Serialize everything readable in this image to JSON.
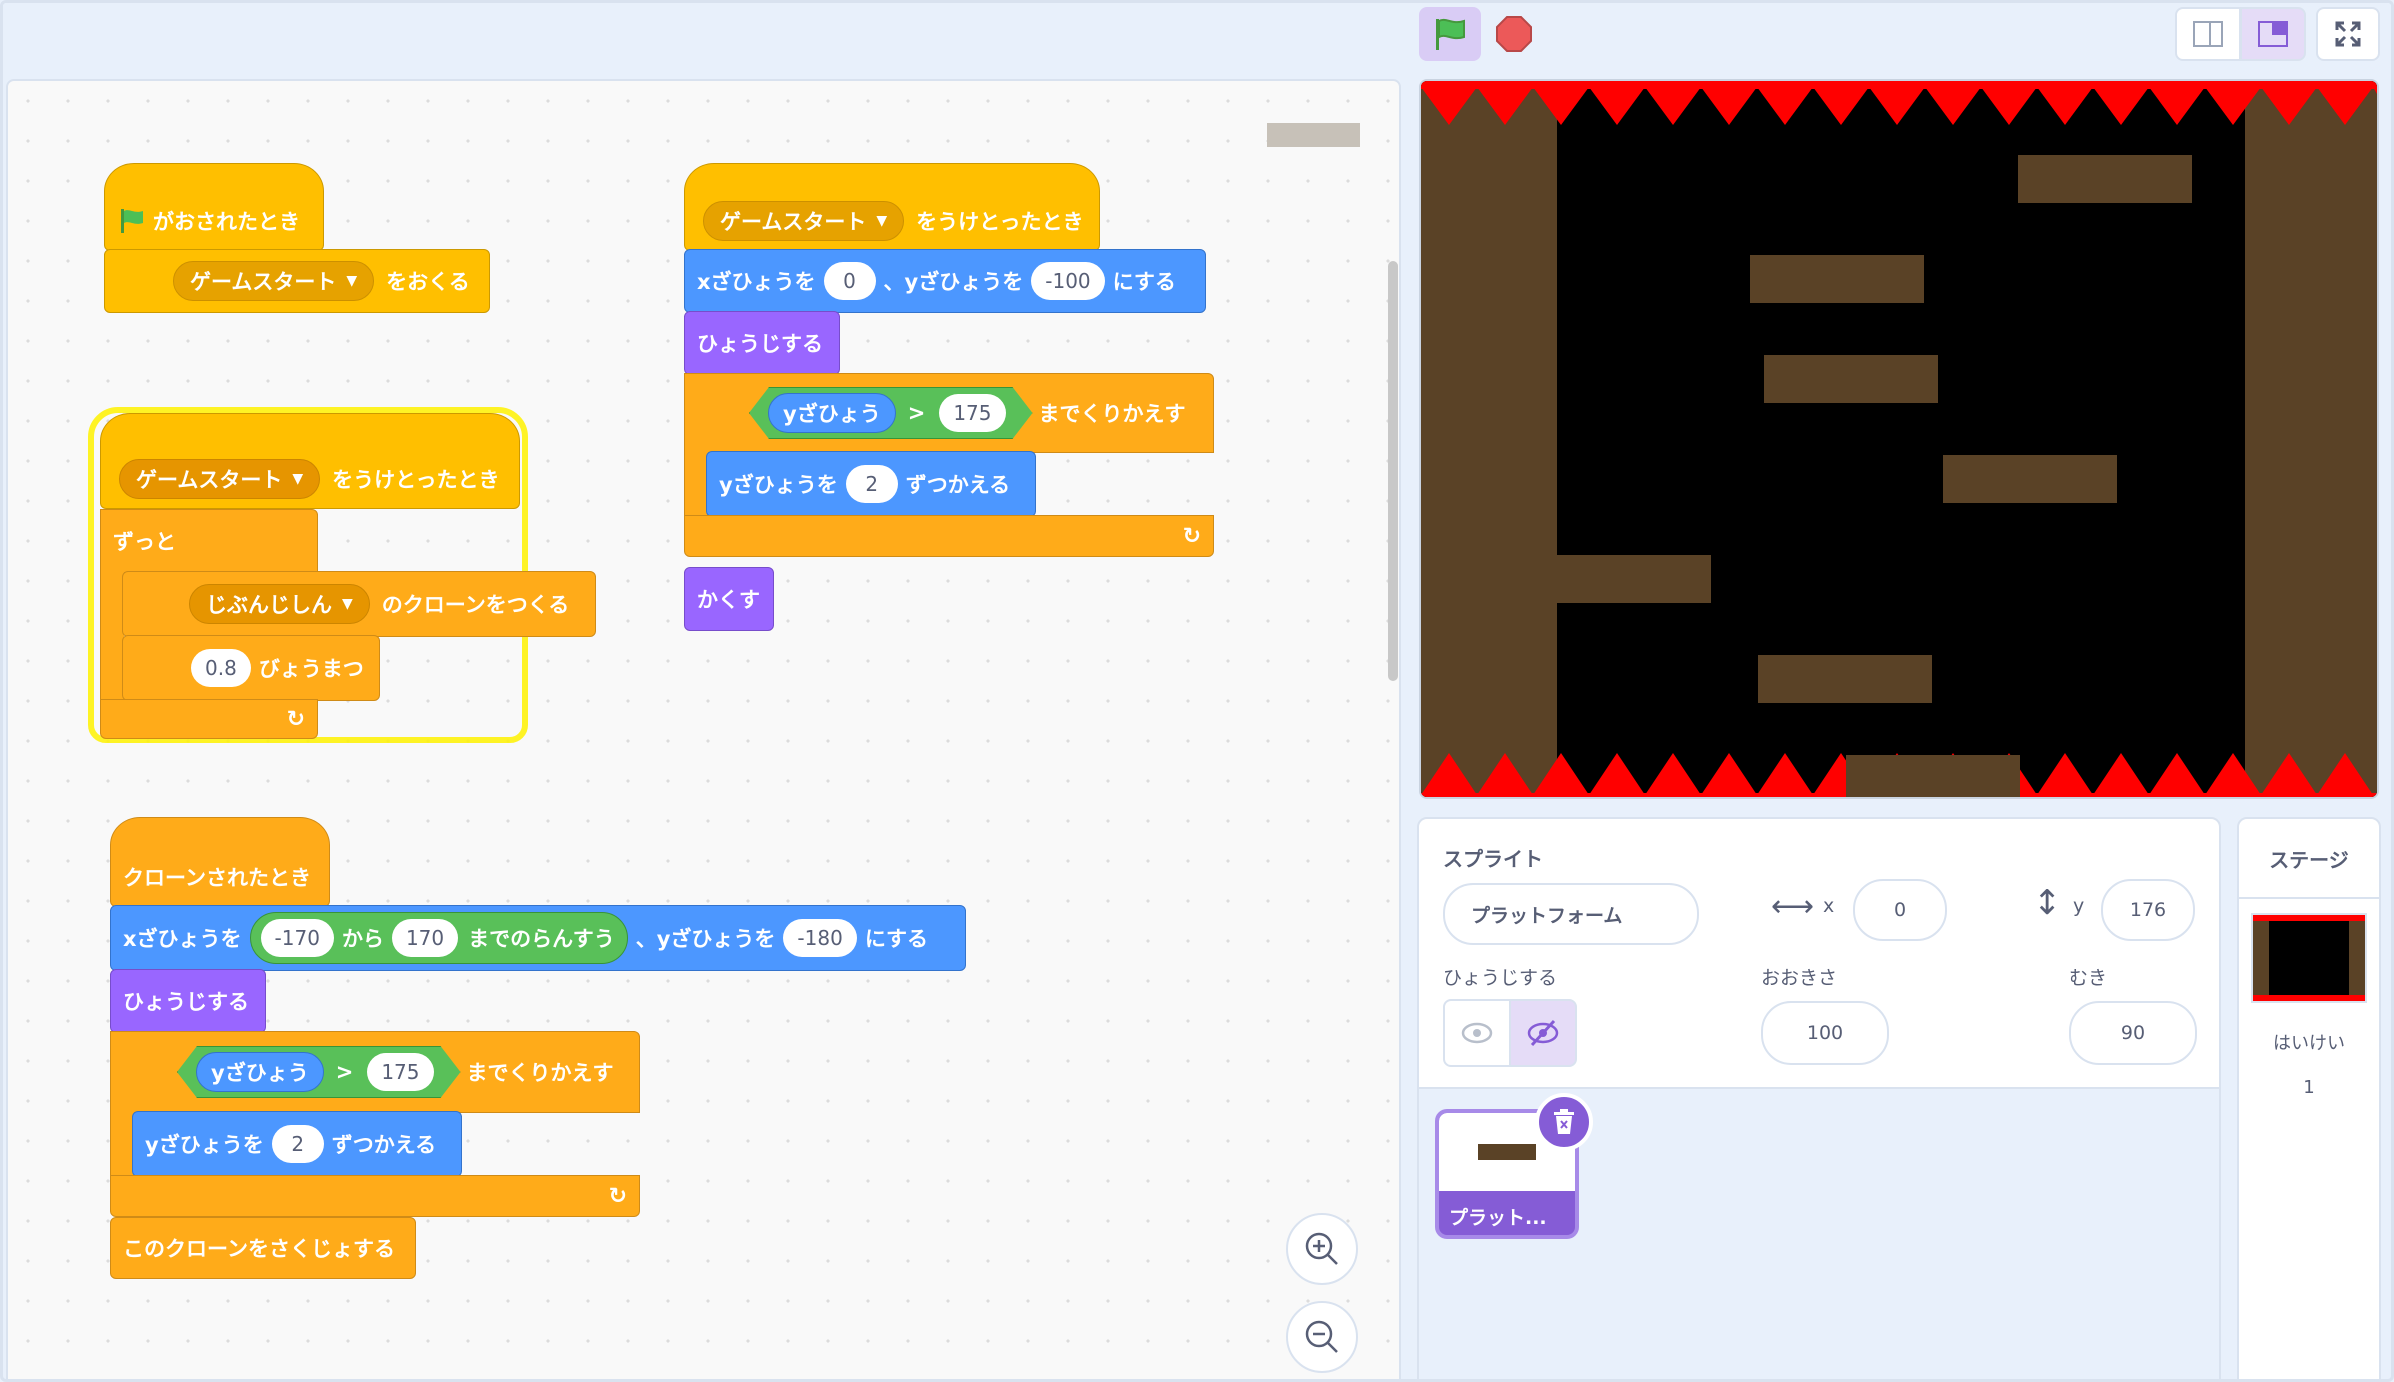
{
  "blocks": {
    "s1": {
      "hat": "がおされたとき",
      "msg": "ゲームスタート",
      "send": "をおくる"
    },
    "s2": {
      "hat_msg": "ゲームスタート",
      "hat_txt": "をうけとったとき",
      "forever": "ずっと",
      "clone_opt": "じぶんじしん",
      "clone_txt": "のクローンをつくる",
      "wait_val": "0.8",
      "wait_txt": "びょうまつ"
    },
    "s3": {
      "hat_msg": "ゲームスタート",
      "hat_txt": "をうけとったとき",
      "goto_x": "xざひょうを",
      "x_val": "0",
      "goto_y": "、yざひょうを",
      "y_val": "-100",
      "goto_end": "にする",
      "show": "ひょうじする",
      "rep_var": "yざひょう",
      "gt": ">",
      "rep_val": "175",
      "rep_txt": "までくりかえす",
      "chg": "yざひょうを",
      "chg_val": "2",
      "chg_txt": "ずつかえる",
      "hide": "かくす"
    },
    "s4": {
      "hat": "クローンされたとき",
      "goto_x": "xざひょうを",
      "rand_from": "-170",
      "rand_kara": "から",
      "rand_to": "170",
      "rand_txt": "までのらんすう",
      "goto_y": "、yざひょうを",
      "y_val": "-180",
      "goto_end": "にする",
      "show": "ひょうじする",
      "rep_var": "yざひょう",
      "gt": ">",
      "rep_val": "175",
      "rep_txt": "までくりかえす",
      "chg": "yざひょうを",
      "chg_val": "2",
      "chg_txt": "ずつかえる",
      "del": "このクローンをさくじょする"
    }
  },
  "sprite_info": {
    "title": "スプライト",
    "name": "プラットフォーム",
    "x_label": "x",
    "x_val": "0",
    "y_label": "y",
    "y_val": "176",
    "show_label": "ひょうじする",
    "size_label": "おおきさ",
    "size_val": "100",
    "dir_label": "むき",
    "dir_val": "90"
  },
  "sprite_tile": {
    "label": "プラット..."
  },
  "stage_panel": {
    "title": "ステージ",
    "bg_label": "はいけい",
    "bg_count": "1"
  },
  "colors": {
    "accent": "#855cd6",
    "events": "#ffbf00",
    "motion": "#4c97ff",
    "looks": "#9966ff",
    "control": "#ffab19",
    "operators": "#59c059"
  }
}
